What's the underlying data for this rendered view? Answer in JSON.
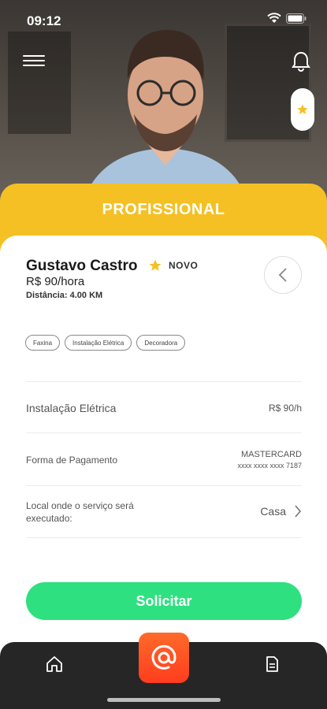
{
  "status_bar": {
    "time": "09:12"
  },
  "header": {
    "title": "PROFISSIONAL"
  },
  "profile": {
    "name": "Gustavo Castro",
    "badge": "NOVO",
    "price": "R$ 90/hora",
    "distance": "Distância: 4.00 KM"
  },
  "tags": [
    "Faxina",
    "Instalação Elétrica",
    "Decoradora"
  ],
  "details": {
    "service_label": "Instalação Elétrica",
    "service_price": "R$ 90/h",
    "payment_label": "Forma de Pagamento",
    "payment_brand": "MASTERCARD",
    "payment_number": "xxxx xxxx xxxx 7187",
    "location_label": "Local onde o serviço será executado:",
    "location_value": "Casa"
  },
  "actions": {
    "request_label": "Solicitar"
  },
  "colors": {
    "accent_yellow": "#f5c023",
    "request_green": "#2ee080",
    "center_nav_orange": "#ff4d22"
  },
  "icons": [
    "menu-icon",
    "bell-icon",
    "star-icon",
    "chevron-left-icon",
    "chevron-right-icon",
    "home-icon",
    "at-sign-icon",
    "document-icon"
  ]
}
